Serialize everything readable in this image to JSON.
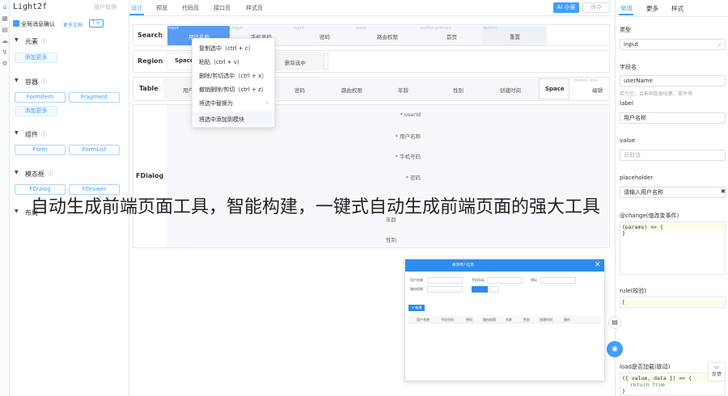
{
  "app": {
    "title": "Light2f",
    "user_link": "用户管理"
  },
  "rail": {
    "icons": [
      "home-icon",
      "component-icon",
      "table-icon",
      "cloud-icon",
      "bolt-icon",
      "gear-icon"
    ]
  },
  "left": {
    "global_msg": "全局消息确认",
    "more_docs": "更多文档",
    "tag_f": "f",
    "tag_x": "✕",
    "groups": [
      {
        "name": "元素",
        "items": [],
        "add": "添加更多"
      },
      {
        "name": "容器",
        "items": [
          "FormItem",
          "Fragment"
        ],
        "add": "添加更多"
      },
      {
        "name": "组件",
        "items": [
          "Form",
          "FormList"
        ]
      },
      {
        "name": "模态框",
        "items": [
          "FDialog",
          "FDrawer"
        ]
      },
      {
        "name": "布局",
        "items": []
      }
    ]
  },
  "topbar": {
    "tabs": [
      "设计",
      "预览",
      "代码页",
      "接口页",
      "样式页"
    ],
    "ai": "AI 小吴",
    "share": "保存"
  },
  "canvas": {
    "search": {
      "label": "Search",
      "cells": [
        "用户名称",
        "手机号码",
        "密码",
        "路由权限",
        "首页",
        "重置"
      ],
      "hints": [
        "input",
        "input",
        "input",
        "input",
        "button-primary",
        "button"
      ]
    },
    "region": {
      "label": "Region",
      "space": "Space",
      "cell": "删除选中"
    },
    "table": {
      "label": "Table",
      "cells": [
        "用户",
        "密码",
        "路由权限",
        "年龄",
        "性别",
        "创建时间"
      ],
      "space": "Space",
      "edit": "编辑",
      "edit_hint": "button: link"
    },
    "fdialog": {
      "label": "FDialog",
      "fields": [
        "* userId",
        "* 用户名称",
        "* 手机号码",
        "* 密码",
        "年龄",
        "性别"
      ]
    }
  },
  "ctxmenu": {
    "items": [
      "复制选中（ctrl + c）",
      "粘贴（ctrl + v）",
      "删除/剪切选中（ctrl + x）",
      "撤销删除/剪切（ctrl + z）",
      "将选中替换为",
      "将选中添加到模块"
    ]
  },
  "overlay": {
    "text": "自动生成前端页面工具，智能构建，一键式自动生成前端页面的强大工具"
  },
  "right": {
    "tabs": [
      "常用",
      "更多",
      "样式"
    ],
    "type_label": "类型",
    "type_value": "input",
    "field_label": "字段名",
    "field_value": "userName",
    "field_hint": "若为空，会影响数据收集、事件等",
    "label_label": "label",
    "label_value": "用户名称",
    "value_label": "value",
    "value_placeholder": "获取值",
    "placeholder_label": "placeholder",
    "placeholder_value": "请输入用户名称",
    "onchange_label": "@change(值改变事件)",
    "onchange_code_1": "(params) => {",
    "onchange_code_2": "}",
    "rule_label": "rule(校验)",
    "rule_code": "[",
    "load_label": "load是否加载(联动)",
    "load_code_1": "({ value, data }) => {",
    "load_code_2": "return true",
    "load_code_3": "}",
    "feedback": "反馈"
  },
  "preview": {
    "head": "修改用户信息",
    "fields": [
      "用户名称",
      "手机号码",
      "密码",
      "路由权限"
    ],
    "labels": [
      "路由权限",
      "年龄"
    ],
    "btn_add": "+ 新增",
    "cols": [
      "用户名称",
      "手机号码",
      "密码",
      "路由权限",
      "年龄",
      "性别",
      "创建时间",
      "操作"
    ]
  },
  "colors": {
    "accent": "#409eff",
    "header": "#2d8cf0",
    "yellow": "#fffbe6"
  }
}
